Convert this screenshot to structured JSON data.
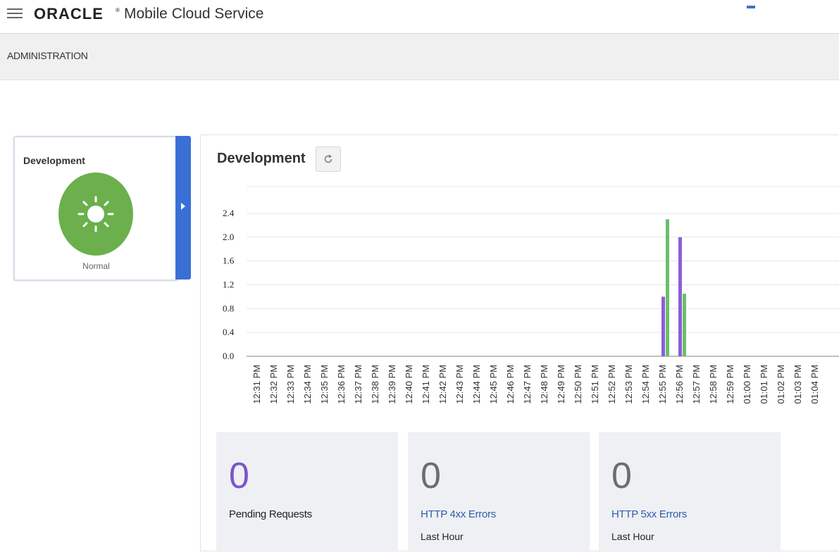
{
  "header": {
    "brand": "ORACLE",
    "brand_mark": "®",
    "product": "Mobile Cloud Service"
  },
  "subheader": {
    "title": "ADMINISTRATION"
  },
  "environment_card": {
    "title": "Development",
    "status": "Normal",
    "status_icon": "sun-icon",
    "status_color": "#6bb04d"
  },
  "panel": {
    "title": "Development",
    "refresh_icon": "refresh-icon"
  },
  "chart_data": {
    "type": "bar",
    "categories": [
      "12:31 PM",
      "12:32 PM",
      "12:33 PM",
      "12:34 PM",
      "12:35 PM",
      "12:36 PM",
      "12:37 PM",
      "12:38 PM",
      "12:39 PM",
      "12:40 PM",
      "12:41 PM",
      "12:42 PM",
      "12:43 PM",
      "12:44 PM",
      "12:45 PM",
      "12:46 PM",
      "12:47 PM",
      "12:48 PM",
      "12:49 PM",
      "12:50 PM",
      "12:51 PM",
      "12:52 PM",
      "12:53 PM",
      "12:54 PM",
      "12:55 PM",
      "12:56 PM",
      "12:57 PM",
      "12:58 PM",
      "12:59 PM",
      "01:00 PM",
      "01:01 PM",
      "01:02 PM",
      "01:03 PM",
      "01:04 PM"
    ],
    "series": [
      {
        "color": "#8a5fd6",
        "values": [
          0,
          0,
          0,
          0,
          0,
          0,
          0,
          0,
          0,
          0,
          0,
          0,
          0,
          0,
          0,
          0,
          0,
          0,
          0,
          0,
          0,
          0,
          0,
          0,
          1.0,
          2.0,
          0,
          0,
          0,
          0,
          0,
          0,
          0,
          0
        ]
      },
      {
        "color": "#6bbf6a",
        "values": [
          0,
          0,
          0,
          0,
          0,
          0,
          0,
          0,
          0,
          0,
          0,
          0,
          0,
          0,
          0,
          0,
          0,
          0,
          0,
          0,
          0,
          0,
          0,
          0,
          2.3,
          1.05,
          0,
          0,
          0,
          0,
          0,
          0,
          0,
          0
        ]
      }
    ],
    "yticks": [
      "0.0",
      "0.4",
      "0.8",
      "1.2",
      "1.6",
      "2.0",
      "2.4"
    ],
    "ylim": [
      0,
      2.8
    ],
    "grid": true
  },
  "metrics": [
    {
      "value": "0",
      "value_color": "#7b57c8",
      "label": "Pending Requests",
      "is_link": false,
      "sublabel": ""
    },
    {
      "value": "0",
      "value_color": "#6d6d6d",
      "label": "HTTP 4xx Errors",
      "is_link": true,
      "sublabel": "Last Hour"
    },
    {
      "value": "0",
      "value_color": "#6d6d6d",
      "label": "HTTP 5xx Errors",
      "is_link": true,
      "sublabel": "Last Hour"
    }
  ]
}
